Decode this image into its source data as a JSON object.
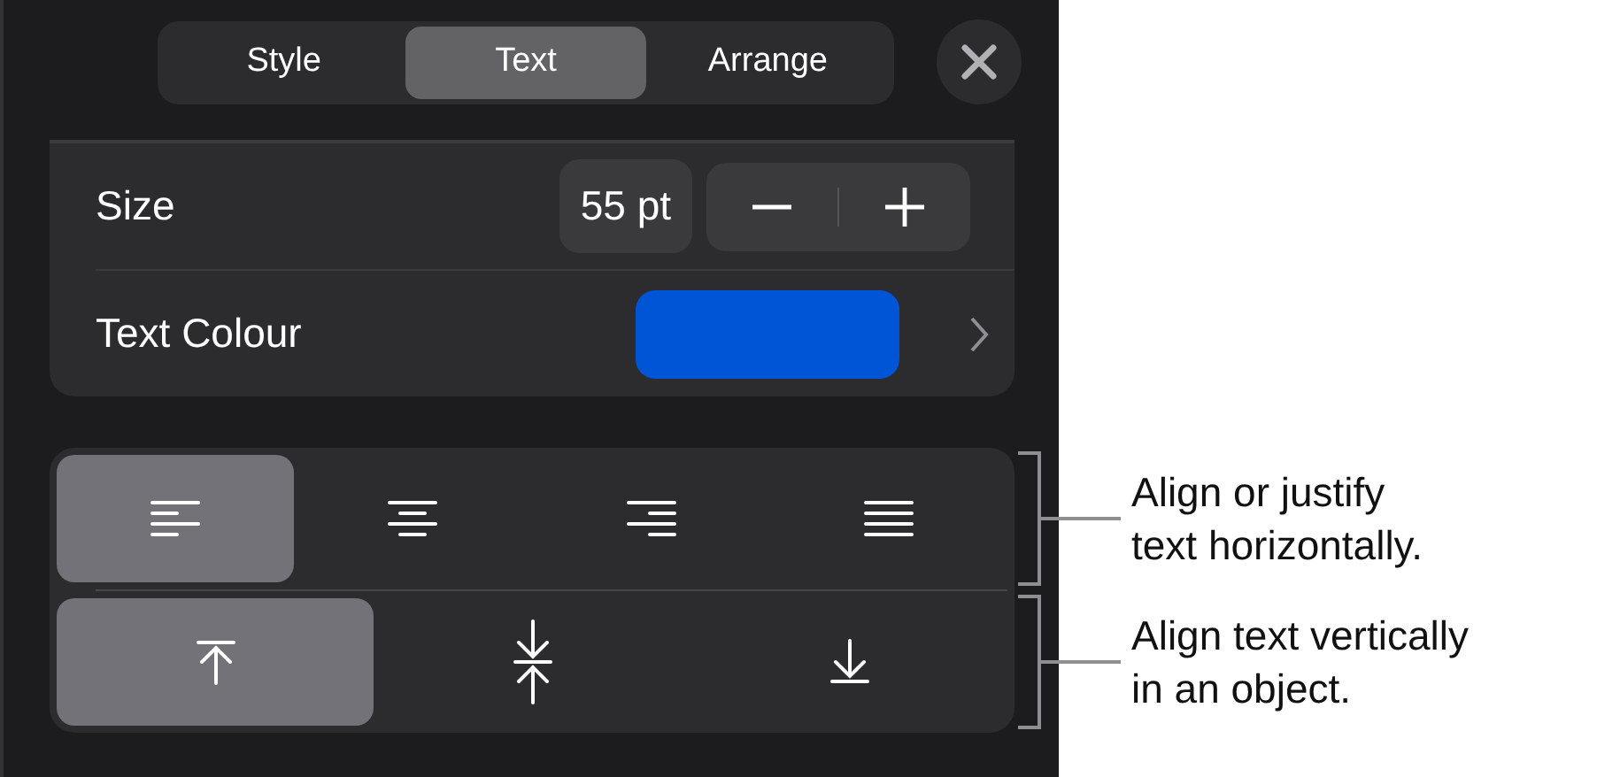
{
  "tabs": [
    {
      "label": "Style",
      "selected": false
    },
    {
      "label": "Text",
      "selected": true
    },
    {
      "label": "Arrange",
      "selected": false
    }
  ],
  "size": {
    "label": "Size",
    "value": "55 pt"
  },
  "text_colour": {
    "label": "Text Colour",
    "color": "#0055d6"
  },
  "horizontal_alignment": [
    {
      "kind": "left",
      "selected": true
    },
    {
      "kind": "center",
      "selected": false
    },
    {
      "kind": "right",
      "selected": false
    },
    {
      "kind": "justify",
      "selected": false
    }
  ],
  "vertical_alignment": [
    {
      "kind": "top",
      "selected": true
    },
    {
      "kind": "middle",
      "selected": false
    },
    {
      "kind": "bottom",
      "selected": false
    }
  ],
  "callouts": [
    "Align or justify\ntext horizontally.",
    "Align text vertically\nin an object."
  ]
}
